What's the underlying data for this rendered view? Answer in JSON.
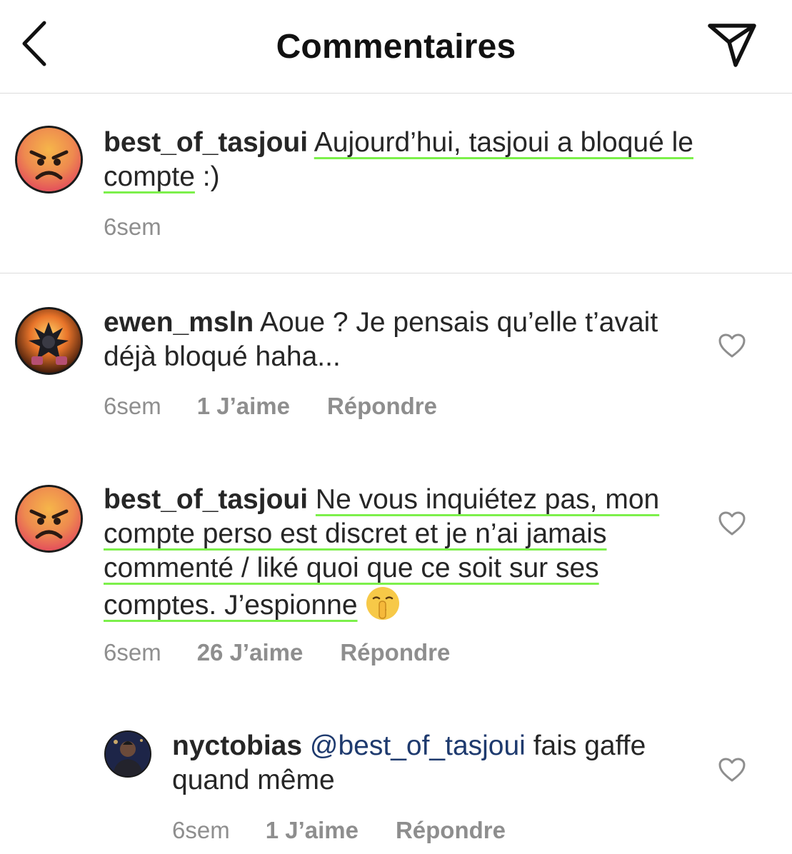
{
  "header": {
    "title": "Commentaires"
  },
  "caption": {
    "username": "best_of_tasjoui",
    "text_part1": "Aujourd’hui, tasjoui a bloqué le compte",
    "text_part2": " :)",
    "time": "6sem"
  },
  "comments": [
    {
      "username": "ewen_msln",
      "text": "Aoue ? Je pensais qu’elle t’avait déjà bloqué haha...",
      "time": "6sem",
      "likes": "1 J’aime",
      "reply": "Répondre"
    },
    {
      "username": "best_of_tasjoui",
      "text": "Ne vous inquiétez pas, mon compte perso est discret et je n’ai jamais commenté / liké quoi que ce soit sur ses comptes. J’espionne",
      "emoji": "🤫",
      "time": "6sem",
      "likes": "26 J’aime",
      "reply": "Répondre"
    },
    {
      "username": "nyctobias",
      "mention": "@best_of_tasjoui",
      "text": " fais gaffe quand même",
      "time": "6sem",
      "likes": "1 J’aime",
      "reply": "Répondre"
    }
  ],
  "colors": {
    "highlight_underline": "#7cf04b",
    "mention": "#1e3a6e",
    "meta_gray": "#8e8e8e"
  }
}
